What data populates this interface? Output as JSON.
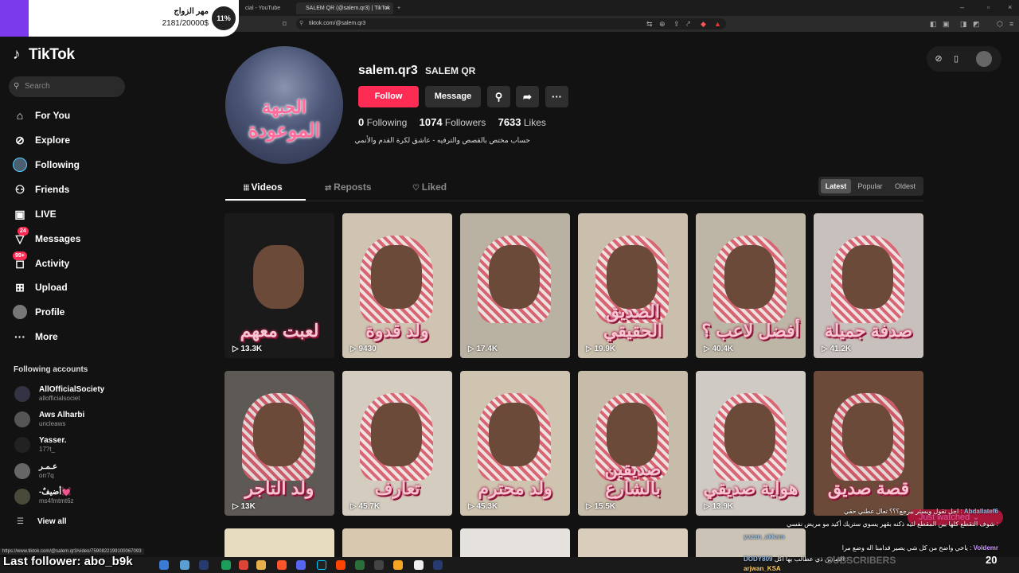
{
  "browser": {
    "tabs": [
      {
        "label": "cial - YouTube"
      },
      {
        "label": "SALEM QR (@salem.qr3) | TikTok"
      }
    ],
    "new_tab_symbol": "+",
    "url": "tiktok.com/@salem.qr3"
  },
  "overlay": {
    "donation_title": "مهر الزواج",
    "donation_amount": "2181/20000$",
    "donation_percent": "11%",
    "last_follower": "Last follower: abo_b9k",
    "subscribers_label": "SUBSCRIBERS",
    "subscribers_count": "20",
    "just_watched": "Just watched",
    "status_url": "https://www.tiktok.com/@salem.qr3/video/7590822199100067093"
  },
  "chat": [
    {
      "user": "Abdallatef6",
      "text": "اجل تقول ويستر بيرجع؟؟؟ تعال عطني حقي :"
    },
    {
      "user": "",
      "text": "شوف التقطع كلها بين المقطع لئيه ذكنه بقهر يسوي ستريك أكيد مو مريض نفسي :"
    },
    {
      "user": "yazan_akkam",
      "text": "ياخي واضح من كل شي يصير قدامنا اله وضع مرا :"
    },
    {
      "user": "Voldemr",
      "text": ""
    },
    {
      "user": "DODY809",
      "text": "الثمانين ذي عطالب بها اكل :"
    },
    {
      "user": "arjwan_KSA",
      "text": ""
    }
  ],
  "sidebar": {
    "logo": "TikTok",
    "search_placeholder": "Search",
    "nav": [
      {
        "label": "For You",
        "icon": "home-icon"
      },
      {
        "label": "Explore",
        "icon": "compass-icon"
      },
      {
        "label": "Following",
        "icon": "following-avatar-icon"
      },
      {
        "label": "Friends",
        "icon": "friends-icon"
      },
      {
        "label": "LIVE",
        "icon": "live-icon"
      },
      {
        "label": "Messages",
        "icon": "messages-icon",
        "badge": "24"
      },
      {
        "label": "Activity",
        "icon": "activity-icon",
        "badge": "99+"
      },
      {
        "label": "Upload",
        "icon": "upload-icon"
      },
      {
        "label": "Profile",
        "icon": "profile-icon"
      },
      {
        "label": "More",
        "icon": "more-icon"
      }
    ],
    "following_header": "Following accounts",
    "accounts": [
      {
        "name": "AllOfficialSociety",
        "handle": "allofficialsociet"
      },
      {
        "name": "Aws Alharbi",
        "handle": "uncleaws"
      },
      {
        "name": "Yasser.",
        "handle": "17?t_"
      },
      {
        "name": "عـمـر",
        "handle": "orr7q"
      },
      {
        "name": "-أضيفٌ💓",
        "handle": "ms4fmtmt6z"
      }
    ],
    "view_all": "View all"
  },
  "profile": {
    "username": "salem.qr3",
    "display_name": "SALEM QR",
    "avatar_text_1": "الجبهة",
    "avatar_text_2": "الموعودة",
    "follow_label": "Follow",
    "message_label": "Message",
    "following_count": "0",
    "following_label": "Following",
    "followers_count": "1074",
    "followers_label": "Followers",
    "likes_count": "7633",
    "likes_label": "Likes",
    "bio": "حساب مختص بالقصص والترفيه - عاشق لكرة القدم والأنمي"
  },
  "tabs": [
    {
      "label": "Videos"
    },
    {
      "label": "Reposts"
    },
    {
      "label": "Liked"
    }
  ],
  "sort": [
    "Latest",
    "Popular",
    "Oldest"
  ],
  "videos": [
    {
      "caption": "لعبت معهم",
      "views": "13.3K",
      "bg": "#1a1a1a"
    },
    {
      "caption": "ولد قدوة",
      "views": "9430",
      "bg": "#cfc4b2"
    },
    {
      "caption": "",
      "views": "17.4K",
      "bg": "#b9b2a2"
    },
    {
      "caption": "الصديق الحقيقي",
      "views": "19.9K",
      "bg": "#c9bfac"
    },
    {
      "caption": "أفضل لاعب ؟",
      "views": "40.4K",
      "bg": "#bdb6a6"
    },
    {
      "caption": "صدفة جميلة",
      "views": "41.2K",
      "bg": "#c8c0bc"
    },
    {
      "caption": "ولد التاجر",
      "views": "13K",
      "bg": "#5d5a55"
    },
    {
      "caption": "تعارف",
      "views": "45.7K",
      "bg": "#d4ccbf"
    },
    {
      "caption": "ولد محترم",
      "views": "45.3K",
      "bg": "#cfc4b0"
    },
    {
      "caption": "صديقين بالشارع",
      "views": "15.5K",
      "bg": "#c7bca9"
    },
    {
      "caption": "هواية صديقي",
      "views": "13.9K",
      "bg": "#d0cac4"
    },
    {
      "caption": "قصة صديق",
      "views": "",
      "bg": "#6b4a3a"
    }
  ]
}
